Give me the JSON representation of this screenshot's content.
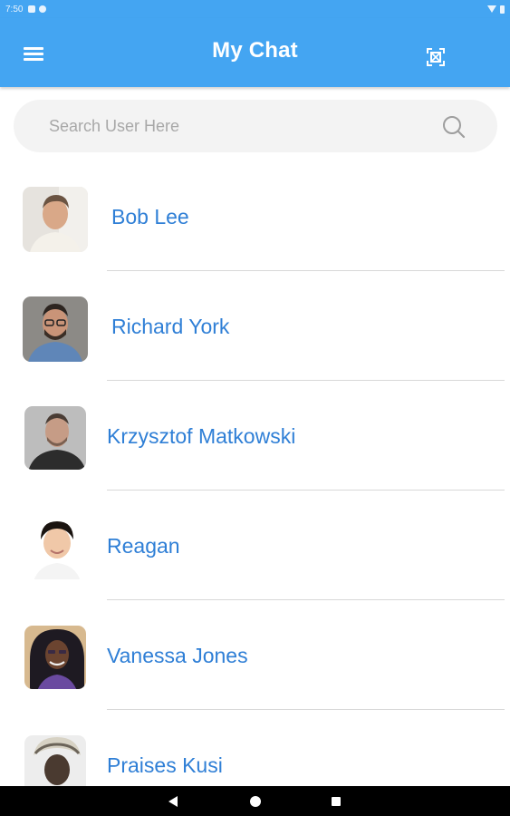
{
  "status_bar": {
    "time": "7:50"
  },
  "app_bar": {
    "title": "My Chat"
  },
  "search": {
    "placeholder": "Search User Here"
  },
  "colors": {
    "primary": "#44a5f2",
    "name_text": "#2f7fd6",
    "search_bg": "#f3f3f3"
  },
  "users": [
    {
      "name": "Bob Lee",
      "avatar": "man-headshot-light-shirt"
    },
    {
      "name": "Richard York",
      "avatar": "man-with-glasses-and-beard"
    },
    {
      "name": "Krzysztof Matkowski",
      "avatar": "man-dark-tshirt"
    },
    {
      "name": "Reagan",
      "avatar": "young-man-smiling"
    },
    {
      "name": "Vanessa Jones",
      "avatar": "woman-curly-hair"
    },
    {
      "name": "Praises Kusi",
      "avatar": "woman-headwrap"
    }
  ]
}
